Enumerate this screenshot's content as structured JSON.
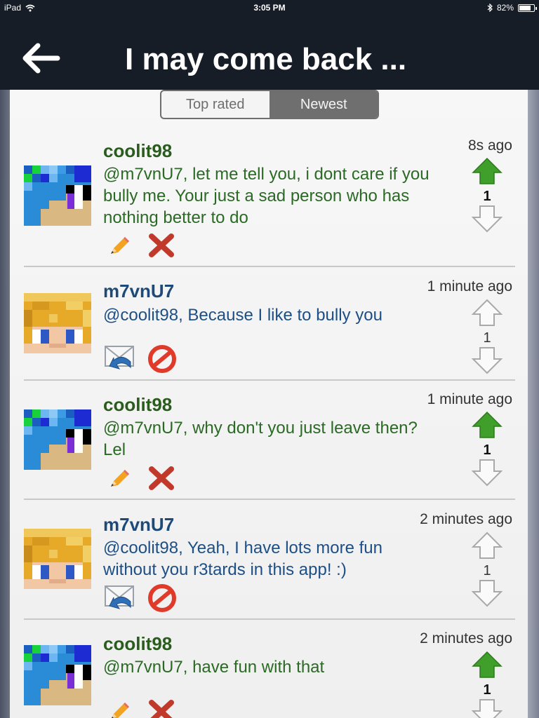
{
  "status_bar": {
    "device": "iPad",
    "time": "3:05 PM",
    "battery": "82%",
    "battery_level": 0.82
  },
  "nav": {
    "title": "I may come back ..."
  },
  "tabs": [
    {
      "label": "Top rated",
      "active": false
    },
    {
      "label": "Newest",
      "active": true
    }
  ],
  "comments": [
    {
      "author": "coolit98",
      "text": "@m7vnU7, let me tell you, i dont care if you bully me. Your just a sad person who has nothing better to do",
      "time": "8s ago",
      "votes": "1",
      "upvoted": true,
      "own": true
    },
    {
      "author": "m7vnU7",
      "text": "@coolit98, Because I like to bully you",
      "time": "1 minute ago",
      "votes": "1",
      "upvoted": false,
      "own": false
    },
    {
      "author": "coolit98",
      "text": "@m7vnU7, why don't you just leave then? Lel",
      "time": "1 minute ago",
      "votes": "1",
      "upvoted": true,
      "own": true
    },
    {
      "author": "m7vnU7",
      "text": "@coolit98, Yeah, I have lots more fun without you r3tards in this app! :)",
      "time": "2 minutes ago",
      "votes": "1",
      "upvoted": false,
      "own": false
    },
    {
      "author": "coolit98",
      "text": "@m7vnU7, have fun with that",
      "time": "2 minutes ago",
      "votes": "1",
      "upvoted": true,
      "own": true
    }
  ],
  "colors": {
    "nav_bg": "#161d27",
    "own_author": "#2a5d1d",
    "other_author": "#1d4a79",
    "upvote_active": "#3f9f2a"
  },
  "icons": {
    "back": "arrow-left-icon",
    "edit": "pencil-icon",
    "delete": "x-icon",
    "reply": "reply-mail-icon",
    "report": "prohibited-icon",
    "upvote": "arrow-up-icon",
    "downvote": "arrow-down-icon"
  }
}
